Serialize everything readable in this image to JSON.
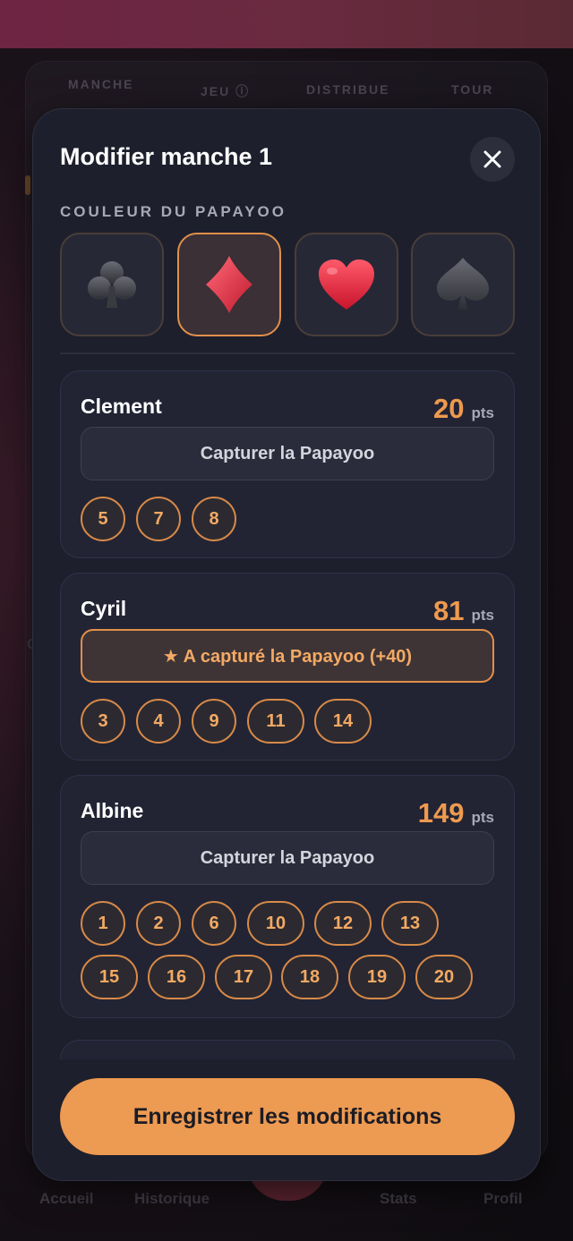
{
  "background": {
    "table_headers": [
      "MANCHE",
      "JEU ⓘ",
      "DISTRIBUE",
      "TOUR"
    ],
    "side_letter": "C",
    "nav": [
      "Accueil",
      "Historique",
      "Stats",
      "Profil"
    ]
  },
  "modal": {
    "title": "Modifier manche 1",
    "close_icon": "close-icon",
    "suit_label": "COULEUR DU PAPAYOO",
    "suits": [
      {
        "name": "clubs",
        "icon": "club-icon",
        "selected": false,
        "color": "#3c3d44"
      },
      {
        "name": "diamonds",
        "icon": "diamond-icon",
        "selected": true,
        "color": "#e33444"
      },
      {
        "name": "hearts",
        "icon": "heart-icon",
        "selected": false,
        "color": "#e8304a"
      },
      {
        "name": "spades",
        "icon": "spade-icon",
        "selected": false,
        "color": "#3c3d44"
      }
    ],
    "players": [
      {
        "name": "Clement",
        "score": "20",
        "unit": "pts",
        "capture_label": "Capturer la Papayoo",
        "captured": false,
        "cards": [
          "5",
          "7",
          "8"
        ]
      },
      {
        "name": "Cyril",
        "score": "81",
        "unit": "pts",
        "capture_label": "★ A capturé la Papayoo (+40)",
        "captured": true,
        "cards": [
          "3",
          "4",
          "9",
          "11",
          "14"
        ]
      },
      {
        "name": "Albine",
        "score": "149",
        "unit": "pts",
        "capture_label": "Capturer la Papayoo",
        "captured": false,
        "cards": [
          "1",
          "2",
          "6",
          "10",
          "12",
          "13",
          "15",
          "16",
          "17",
          "18",
          "19",
          "20"
        ]
      }
    ],
    "save_label": "Enregistrer les modifications"
  },
  "colors": {
    "accent": "#ed9a52",
    "modal_bg": "#1d1f2c",
    "card_bg": "#222434"
  }
}
